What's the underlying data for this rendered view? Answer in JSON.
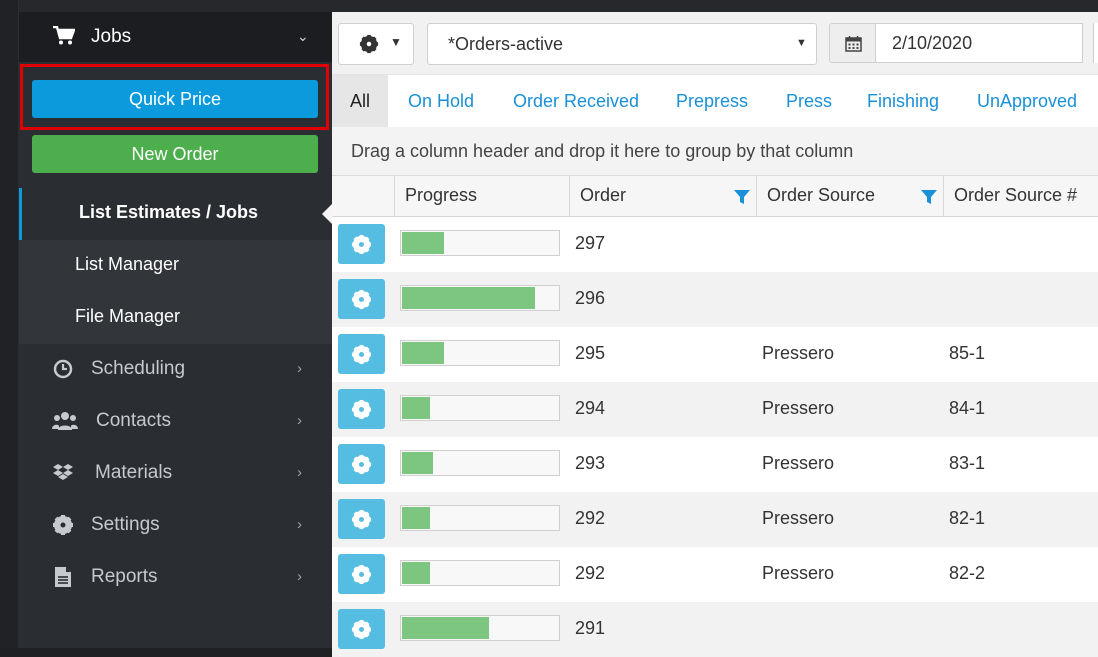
{
  "sidebar": {
    "section": {
      "label": "Jobs",
      "icon": "shopping-cart-icon"
    },
    "quick_price_label": "Quick Price",
    "new_order_label": "New Order",
    "subitems": [
      {
        "label": "List Estimates / Jobs",
        "active": true
      },
      {
        "label": "List Manager",
        "active": false
      },
      {
        "label": "File Manager",
        "active": false
      }
    ],
    "menu": [
      {
        "label": "Scheduling",
        "icon": "clock-icon"
      },
      {
        "label": "Contacts",
        "icon": "users-icon"
      },
      {
        "label": "Materials",
        "icon": "dropbox-icon"
      },
      {
        "label": "Settings",
        "icon": "gear-icon"
      },
      {
        "label": "Reports",
        "icon": "file-icon"
      }
    ]
  },
  "toolbar": {
    "view_value": "*Orders-active",
    "date_value": "2/10/2020"
  },
  "tabs": [
    "All",
    "On Hold",
    "Order Received",
    "Prepress",
    "Press",
    "Finishing",
    "UnApproved"
  ],
  "group_hint": "Drag a column header and drop it here to group by that column",
  "columns": [
    "Progress",
    "Order",
    "Order Source",
    "Order Source #"
  ],
  "rows": [
    {
      "progress": 0.27,
      "order": "297",
      "source": "",
      "source_no": ""
    },
    {
      "progress": 0.85,
      "order": "296",
      "source": "",
      "source_no": ""
    },
    {
      "progress": 0.27,
      "order": "295",
      "source": "Pressero",
      "source_no": "85-1"
    },
    {
      "progress": 0.18,
      "order": "294",
      "source": "Pressero",
      "source_no": "84-1"
    },
    {
      "progress": 0.2,
      "order": "293",
      "source": "Pressero",
      "source_no": "83-1"
    },
    {
      "progress": 0.18,
      "order": "292",
      "source": "Pressero",
      "source_no": "82-1"
    },
    {
      "progress": 0.18,
      "order": "292",
      "source": "Pressero",
      "source_no": "82-2"
    },
    {
      "progress": 0.56,
      "order": "291",
      "source": "",
      "source_no": ""
    }
  ],
  "colors": {
    "accent": "#0b9adb",
    "success": "#4cae4c",
    "progress": "#7dc67f",
    "row_button": "#55bde2",
    "highlight": "#e00000"
  }
}
